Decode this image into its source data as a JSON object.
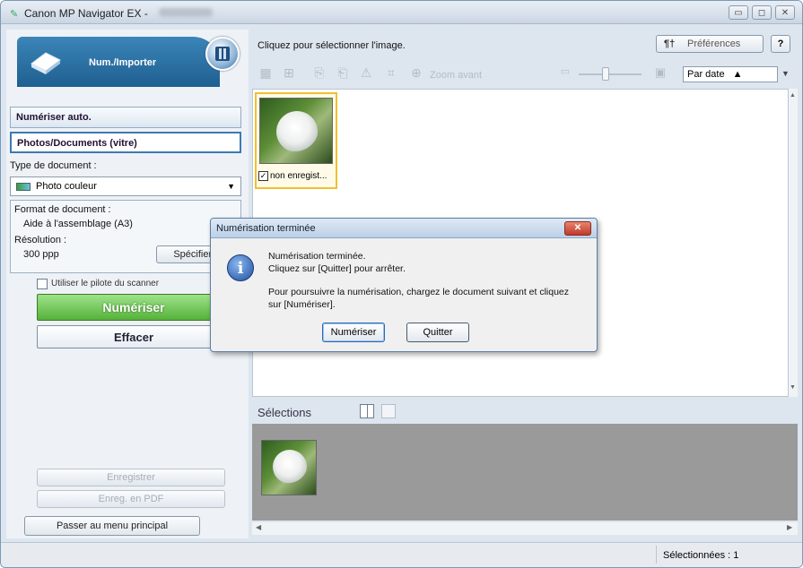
{
  "window": {
    "title": "Canon MP Navigator EX -",
    "controls": [
      "minimize-icon",
      "maximize-icon",
      "close-icon"
    ]
  },
  "left_panel": {
    "header_label": "Num./Importer",
    "buttons": {
      "auto_scan": "Numériser auto.",
      "photos_docs": "Photos/Documents (vitre)"
    },
    "doc_type_label": "Type de document :",
    "doc_type_value": "Photo couleur",
    "doc_format_label": "Format de document :",
    "doc_format_value": "Aide à l'assemblage (A3)",
    "resolution_label": "Résolution :",
    "resolution_value": "300 ppp",
    "specify_label": "Spécifier...",
    "use_driver_label": "Utiliser le pilote du scanner",
    "use_driver_checked": false,
    "scan_label": "Numériser",
    "clear_label": "Effacer",
    "save_label": "Enregistrer",
    "save_pdf_label": "Enreg. en PDF",
    "main_menu_label": "Passer au menu principal"
  },
  "right_panel": {
    "hint": "Cliquez pour sélectionner l'image.",
    "preferences_label": "Préférences",
    "help_label": "?",
    "zoom_label": "Zoom avant",
    "sort_value": "Par date",
    "sort_direction_glyph": "▲",
    "thumbnail_caption": "non enregist...",
    "thumbnail_checked": true,
    "selections_label": "Sélections"
  },
  "status": {
    "selected_count": "Sélectionnées : 1"
  },
  "dialog": {
    "title": "Numérisation terminée",
    "line1": "Numérisation terminée.",
    "line2": "Cliquez sur [Quitter] pour arrêter.",
    "line3": "Pour poursuivre la numérisation, chargez le document suivant et cliquez",
    "line4": "sur [Numériser].",
    "scan_button": "Numériser",
    "quit_button": "Quitter",
    "icon": "info-icon"
  },
  "colors": {
    "accent_blue": "#2e6ca1",
    "scan_green": "#55b23a",
    "selection_yellow": "#f0c030",
    "close_red": "#c0392b"
  }
}
